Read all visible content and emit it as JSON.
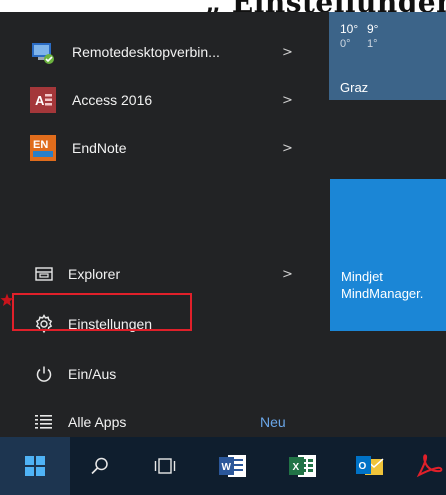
{
  "caption_fragment": "„ Einstellungen",
  "weather": {
    "temps_high": [
      "10°",
      "9°"
    ],
    "temps_low": [
      "0°",
      "1°"
    ],
    "city": "Graz"
  },
  "apps": [
    {
      "label": "Remotedesktopverbin...",
      "icon": "remote-desktop-icon",
      "icon_color": "#2b6cc4",
      "chevron": ">"
    },
    {
      "label": "Access 2016",
      "icon": "access-icon",
      "icon_text": "A",
      "icon_color": "#a4373a",
      "chevron": ">"
    },
    {
      "label": "EndNote",
      "icon": "endnote-icon",
      "icon_text": "EN",
      "icon_color": "#e06c1c",
      "chevron": ">"
    }
  ],
  "system": {
    "explorer": {
      "label": "Explorer",
      "chevron": ">"
    },
    "settings": {
      "label": "Einstellungen"
    },
    "power": {
      "label": "Ein/Aus"
    },
    "all_apps": {
      "label": "Alle Apps",
      "badge": "Neu"
    }
  },
  "tiles": {
    "mindmanager": {
      "label": "Mindjet\nMindManager."
    }
  },
  "highlight_color": "#e0202a",
  "taskbar": [
    "windows-start-icon",
    "search-icon",
    "task-view-icon",
    "word-icon",
    "excel-icon",
    "outlook-icon",
    "acrobat-icon"
  ]
}
